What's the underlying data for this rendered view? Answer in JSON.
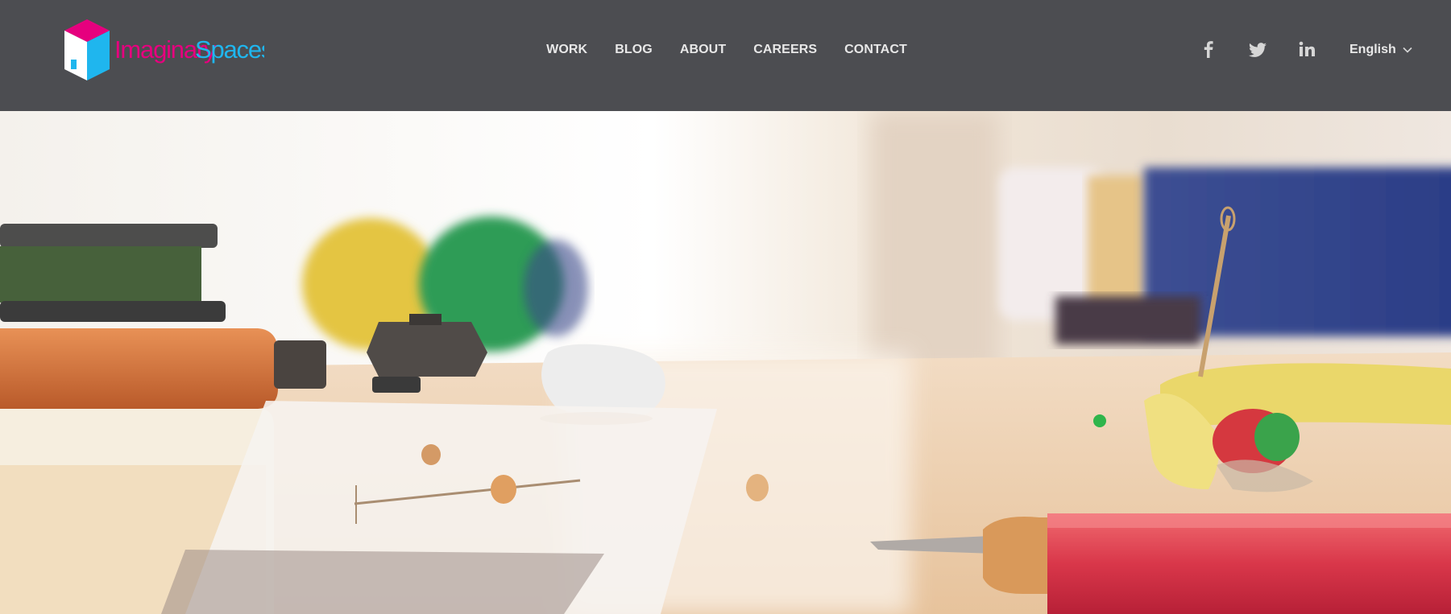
{
  "brand": {
    "name_part1": "Imaginary",
    "name_part2": "Spaces"
  },
  "nav": {
    "work": "WORK",
    "blog": "BLOG",
    "about": "ABOUT",
    "careers": "CAREERS",
    "contact": "CONTACT"
  },
  "social": {
    "facebook_icon": "facebook-icon",
    "twitter_icon": "twitter-icon",
    "linkedin_icon": "linkedin-icon"
  },
  "language": {
    "selected": "English",
    "icon": "chevron-down-icon"
  },
  "colors": {
    "header_bg": "#4c4d51",
    "logo_magenta": "#e6007e",
    "logo_cyan": "#1fb6ee",
    "nav_text": "#e8e8e8"
  },
  "hero": {
    "image": "craft-desk-scene-image"
  }
}
